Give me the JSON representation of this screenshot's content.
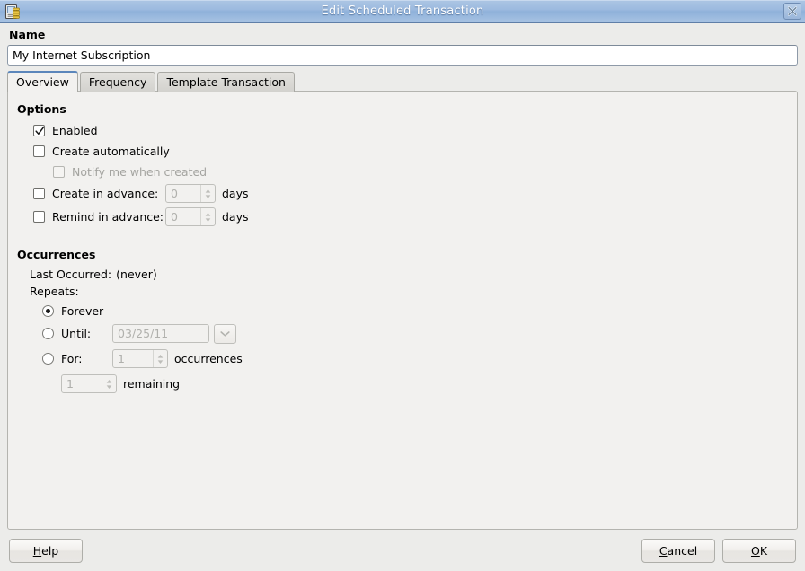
{
  "window": {
    "title": "Edit Scheduled Transaction",
    "icon": "scheduled-transaction-icon",
    "close_label": "✕"
  },
  "name_section": {
    "label": "Name",
    "value": "My Internet Subscription",
    "placeholder": ""
  },
  "tabs": [
    {
      "label": "Overview",
      "active": true
    },
    {
      "label": "Frequency",
      "active": false
    },
    {
      "label": "Template Transaction",
      "active": false
    }
  ],
  "options": {
    "heading": "Options",
    "enabled": {
      "label": "Enabled",
      "checked": true,
      "disabled": false
    },
    "create_automatically": {
      "label": "Create automatically",
      "checked": false,
      "disabled": false
    },
    "notify_me": {
      "label": "Notify me when created",
      "checked": false,
      "disabled": true
    },
    "create_in_advance": {
      "label": "Create in advance:",
      "checked": false,
      "value": "0",
      "unit": "days"
    },
    "remind_in_advance": {
      "label": "Remind in advance:",
      "checked": false,
      "value": "0",
      "unit": "days"
    }
  },
  "occurrences": {
    "heading": "Occurrences",
    "last_occurred_label": "Last Occurred:",
    "last_occurred_value": "(never)",
    "repeats_label": "Repeats:",
    "forever": {
      "label": "Forever",
      "selected": true
    },
    "until": {
      "label": "Until:",
      "selected": false,
      "date": "03/25/11",
      "dropdown_icon": "chevron-down-icon"
    },
    "for": {
      "label": "For:",
      "selected": false,
      "count": "1",
      "unit": "occurrences"
    },
    "remaining": {
      "value": "1",
      "label": "remaining"
    }
  },
  "buttons": {
    "help": {
      "label": "Help",
      "mnemonic": "H"
    },
    "cancel": {
      "label": "Cancel",
      "mnemonic": "C"
    },
    "ok": {
      "label": "OK",
      "mnemonic": "O"
    }
  },
  "colors": {
    "titlebar_start": "#adc6e4",
    "titlebar_end": "#a8c3e3",
    "active_tab_accent": "#5b86bb",
    "window_bg": "#ececea",
    "panel_bg": "#f2f1ef",
    "disabled_text": "#a4a4a0"
  }
}
